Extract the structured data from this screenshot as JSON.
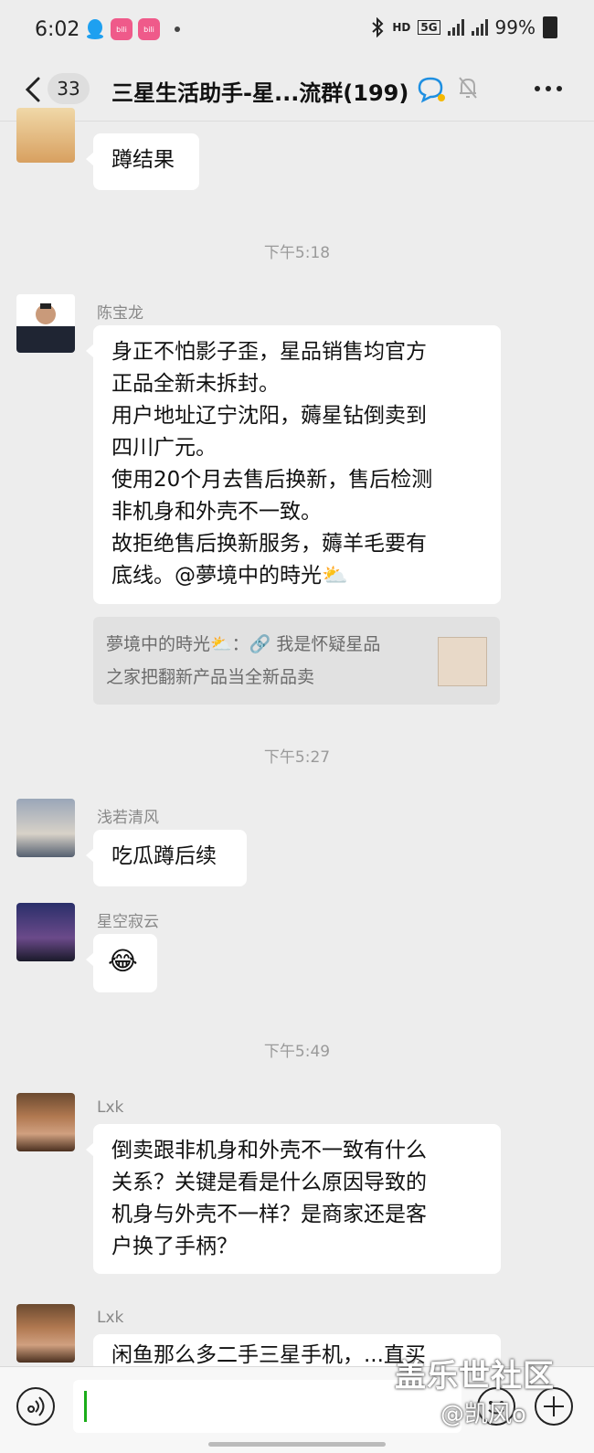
{
  "status_bar": {
    "time": "6:02",
    "hd": "HD",
    "net": "5G",
    "battery": "99%"
  },
  "header": {
    "unread_count": "33",
    "title": "三星生活助手-星...流群(199)"
  },
  "messages": [
    {
      "sender": "",
      "text": "蹲结果"
    },
    {
      "timestamp": "下午5:18"
    },
    {
      "sender": "陈宝龙",
      "lines": [
        "身正不怕影子歪，星品销售均官方",
        "正品全新未拆封。",
        "用户地址辽宁沈阳，薅星钻倒卖到",
        "四川广元。",
        "使用20个月去售后换新，售后检测",
        "非机身和外壳不一致。",
        "故拒绝售后换新服务，薅羊毛要有",
        "底线。@夢境中的時光⛅"
      ],
      "quote": {
        "lines": [
          "夢境中的時光⛅：🔗 我是怀疑星品",
          "之家把翻新产品当全新品卖"
        ]
      }
    },
    {
      "timestamp": "下午5:27"
    },
    {
      "sender": "浅若清风",
      "text": "吃瓜蹲后续"
    },
    {
      "sender": "星空寂云",
      "text": "😂"
    },
    {
      "timestamp": "下午5:49"
    },
    {
      "sender": "Lxk",
      "lines": [
        "倒卖跟非机身和外壳不一致有什么",
        "关系？关键是看是什么原因导致的",
        "机身与外壳不一样？是商家还是客",
        "户换了手柄？"
      ]
    },
    {
      "sender": "Lxk",
      "text": "闲鱼那么多二手三星手机，...直买"
    }
  ],
  "watermark": {
    "line1": "盖乐世社区",
    "line2": "@凯风o"
  }
}
